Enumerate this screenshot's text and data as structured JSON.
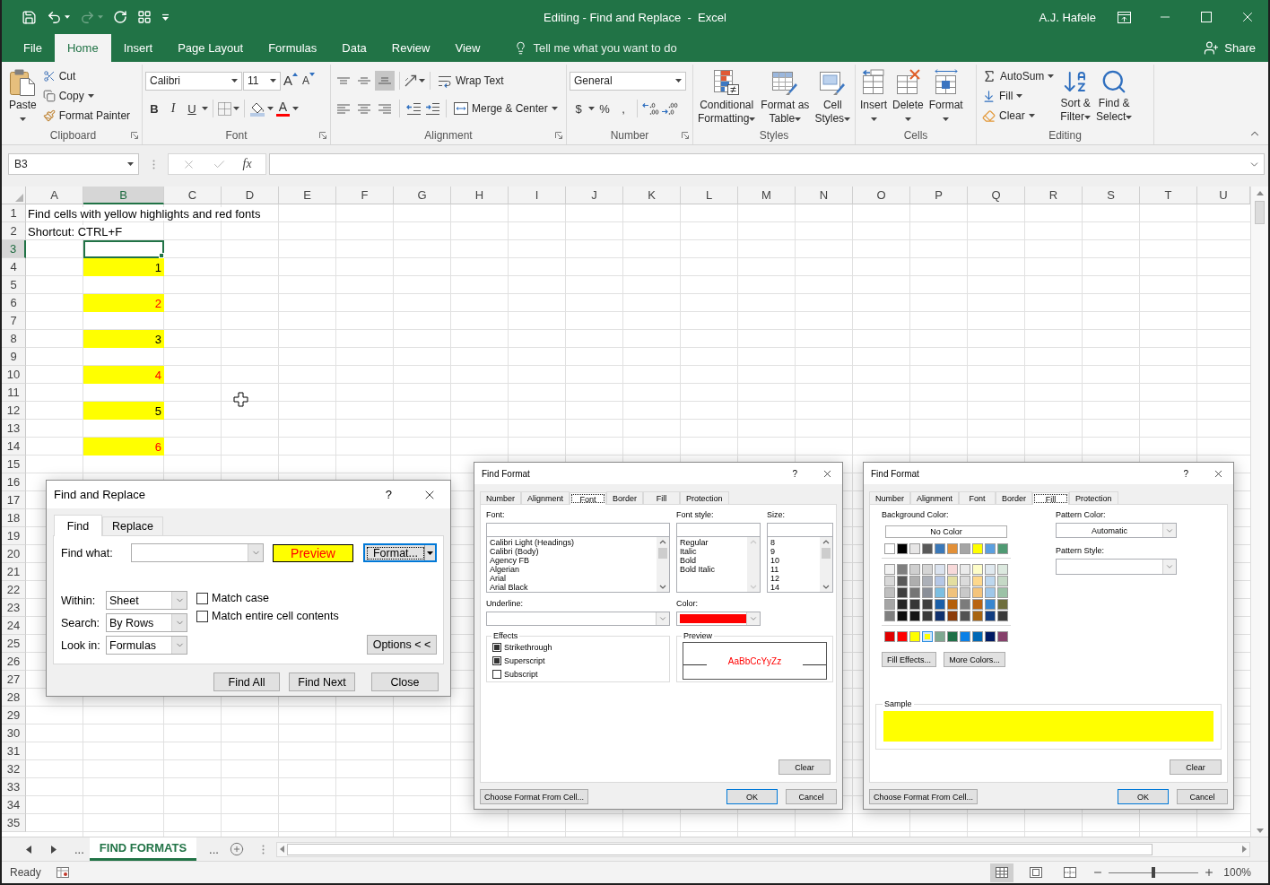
{
  "title_bar": {
    "title": "Editing - Find and Replace  -  Excel",
    "user": "A.J. Hafele"
  },
  "menu": {
    "tabs": [
      {
        "label": "File",
        "selected": false
      },
      {
        "label": "Home",
        "selected": true
      },
      {
        "label": "Insert",
        "selected": false
      },
      {
        "label": "Page Layout",
        "selected": false
      },
      {
        "label": "Formulas",
        "selected": false
      },
      {
        "label": "Data",
        "selected": false
      },
      {
        "label": "Review",
        "selected": false
      },
      {
        "label": "View",
        "selected": false
      }
    ],
    "tell_me": "Tell me what you want to do",
    "share": "Share"
  },
  "ribbon": {
    "clipboard": {
      "label": "Clipboard",
      "paste": "Paste",
      "cut": "Cut",
      "copy": "Copy",
      "format_painter": "Format Painter"
    },
    "font": {
      "label": "Font",
      "name": "Calibri",
      "size": "11",
      "grow": "A",
      "shrink": "A",
      "bold": "B",
      "italic": "I",
      "underline": "U",
      "font_color": "A"
    },
    "alignment": {
      "label": "Alignment",
      "vertical_align": [
        {
          "kind": "top",
          "selected": false
        },
        {
          "kind": "middle",
          "selected": false
        },
        {
          "kind": "bottom",
          "selected": true
        }
      ],
      "horizontal_align": [
        {
          "kind": "left",
          "selected": false
        },
        {
          "kind": "center",
          "selected": false
        },
        {
          "kind": "right",
          "selected": false
        }
      ],
      "wrap_text": "Wrap Text",
      "merge_center": "Merge & Center"
    },
    "number": {
      "label": "Number",
      "format": "General",
      "currency": "$",
      "percent": "%",
      "comma": ","
    },
    "styles": {
      "label": "Styles",
      "buttons": [
        {
          "kind": "conditional",
          "lines": [
            "Conditional",
            "Formatting"
          ]
        },
        {
          "kind": "table",
          "lines": [
            "Format as",
            "Table"
          ]
        },
        {
          "kind": "cell_styles",
          "lines": [
            "Cell",
            "Styles"
          ]
        }
      ]
    },
    "cells": {
      "label": "Cells",
      "buttons": [
        {
          "kind": "insert",
          "label": "Insert"
        },
        {
          "kind": "delete",
          "label": "Delete"
        },
        {
          "kind": "format",
          "label": "Format"
        }
      ]
    },
    "editing": {
      "label": "Editing",
      "autosum": "AutoSum",
      "fill": "Fill",
      "clear": "Clear",
      "sort_lines": [
        "Sort &",
        "Filter"
      ],
      "find_lines": [
        "Find &",
        "Select"
      ]
    }
  },
  "formula_bar": {
    "name_box": "B3",
    "function_button": "fx"
  },
  "sheet": {
    "columns": [
      {
        "label": "A",
        "selected": false
      },
      {
        "label": "B",
        "selected": true
      },
      {
        "label": "C",
        "selected": false
      },
      {
        "label": "D",
        "selected": false
      },
      {
        "label": "E",
        "selected": false
      },
      {
        "label": "F",
        "selected": false
      },
      {
        "label": "G",
        "selected": false
      },
      {
        "label": "H",
        "selected": false
      },
      {
        "label": "I",
        "selected": false
      },
      {
        "label": "J",
        "selected": false
      },
      {
        "label": "K",
        "selected": false
      },
      {
        "label": "L",
        "selected": false
      },
      {
        "label": "M",
        "selected": false
      },
      {
        "label": "N",
        "selected": false
      },
      {
        "label": "O",
        "selected": false
      },
      {
        "label": "P",
        "selected": false
      },
      {
        "label": "Q",
        "selected": false
      },
      {
        "label": "R",
        "selected": false
      },
      {
        "label": "S",
        "selected": false
      },
      {
        "label": "T",
        "selected": false
      },
      {
        "label": "U",
        "selected": false
      }
    ],
    "rows": [
      {
        "number": "1",
        "selected": false,
        "column_a": "Find cells with yellow highlights and red fonts"
      },
      {
        "number": "2",
        "selected": false,
        "column_a": "Shortcut: CTRL+F"
      },
      {
        "number": "3",
        "selected": true,
        "column_b": {
          "active": true
        }
      },
      {
        "number": "4",
        "selected": false,
        "column_b": {
          "value": "1",
          "highlighted": true,
          "red_font": false
        }
      },
      {
        "number": "5",
        "selected": false
      },
      {
        "number": "6",
        "selected": false,
        "column_b": {
          "value": "2",
          "highlighted": true,
          "red_font": true
        }
      },
      {
        "number": "7",
        "selected": false
      },
      {
        "number": "8",
        "selected": false,
        "column_b": {
          "value": "3",
          "highlighted": true,
          "red_font": false
        }
      },
      {
        "number": "9",
        "selected": false
      },
      {
        "number": "10",
        "selected": false,
        "column_b": {
          "value": "4",
          "highlighted": true,
          "red_font": true
        }
      },
      {
        "number": "11",
        "selected": false
      },
      {
        "number": "12",
        "selected": false,
        "column_b": {
          "value": "5",
          "highlighted": true,
          "red_font": false
        }
      },
      {
        "number": "13",
        "selected": false
      },
      {
        "number": "14",
        "selected": false,
        "column_b": {
          "value": "6",
          "highlighted": true,
          "red_font": true
        }
      },
      {
        "number": "15",
        "selected": false
      },
      {
        "number": "16",
        "selected": false
      },
      {
        "number": "17",
        "selected": false
      },
      {
        "number": "18",
        "selected": false
      },
      {
        "number": "19",
        "selected": false
      },
      {
        "number": "20",
        "selected": false
      },
      {
        "number": "21",
        "selected": false
      },
      {
        "number": "22",
        "selected": false
      },
      {
        "number": "23",
        "selected": false
      },
      {
        "number": "24",
        "selected": false
      },
      {
        "number": "25",
        "selected": false
      },
      {
        "number": "26",
        "selected": false
      },
      {
        "number": "27",
        "selected": false
      },
      {
        "number": "28",
        "selected": false
      },
      {
        "number": "29",
        "selected": false
      },
      {
        "number": "30",
        "selected": false
      },
      {
        "number": "31",
        "selected": false
      },
      {
        "number": "32",
        "selected": false
      },
      {
        "number": "33",
        "selected": false
      },
      {
        "number": "34",
        "selected": false
      },
      {
        "number": "35",
        "selected": false
      }
    ]
  },
  "sheet_tabs": {
    "more_before": "...",
    "tabs": [
      {
        "label": "FIND FORMATS",
        "selected": true
      }
    ],
    "more_after": "..."
  },
  "status_bar": {
    "status": "Ready",
    "views": [
      {
        "kind": "normal",
        "selected": true
      },
      {
        "kind": "page_layout",
        "selected": false
      },
      {
        "kind": "page_break",
        "selected": false
      }
    ],
    "zoom": {
      "level": 0.5,
      "reading": "100%"
    }
  },
  "find_replace": {
    "title": "Find and Replace",
    "help": "?",
    "tabs": [
      {
        "label": "Find",
        "selected": true
      },
      {
        "label": "Replace",
        "selected": false
      }
    ],
    "find_what": {
      "label": "Find what:"
    },
    "preview": "Preview",
    "format_button": "Format...",
    "selects": [
      {
        "label": "Within:",
        "value": "Sheet"
      },
      {
        "label": "Search:",
        "value": "By Rows"
      },
      {
        "label": "Look in:",
        "value": "Formulas"
      }
    ],
    "checkboxes": [
      {
        "label": "Match case",
        "checked": false
      },
      {
        "label": "Match entire cell contents",
        "checked": false
      }
    ],
    "options_button": "Options < <",
    "buttons": [
      "Find All",
      "Find Next",
      "Close"
    ]
  },
  "font_dialog": {
    "title": "Find Format",
    "help": "?",
    "tabs": [
      {
        "label": "Number",
        "selected": false
      },
      {
        "label": "Alignment",
        "selected": false
      },
      {
        "label": "Font",
        "selected": true
      },
      {
        "label": "Border",
        "selected": false
      },
      {
        "label": "Fill",
        "selected": false
      },
      {
        "label": "Protection",
        "selected": false
      }
    ],
    "lists": [
      {
        "label": "Font:",
        "items": [
          "Calibri Light (Headings)",
          "Calibri (Body)",
          "Agency FB",
          "Algerian",
          "Arial",
          "Arial Black"
        ]
      },
      {
        "label": "Font style:",
        "items": [
          "Regular",
          "Italic",
          "Bold",
          "Bold Italic"
        ]
      },
      {
        "label": "Size:",
        "items": [
          "8",
          "9",
          "10",
          "11",
          "12",
          "14"
        ]
      }
    ],
    "underline": {
      "label": "Underline:"
    },
    "color": {
      "label": "Color:",
      "color": "#ff0000"
    },
    "effects": {
      "label": "Effects",
      "items": [
        {
          "label": "Strikethrough",
          "checked": false,
          "mixed": true
        },
        {
          "label": "Superscript",
          "checked": false,
          "mixed": true
        },
        {
          "label": "Subscript",
          "checked": false,
          "mixed": false
        }
      ]
    },
    "preview": {
      "label": "Preview",
      "sample": "AaBbCcYyZz"
    },
    "clear": "Clear",
    "choose_from_cell": "Choose Format From Cell...",
    "ok": "OK",
    "cancel": "Cancel"
  },
  "fill_dialog": {
    "title": "Find Format",
    "help": "?",
    "tabs": [
      {
        "label": "Number",
        "selected": false
      },
      {
        "label": "Alignment",
        "selected": false
      },
      {
        "label": "Font",
        "selected": false
      },
      {
        "label": "Border",
        "selected": false
      },
      {
        "label": "Fill",
        "selected": true
      },
      {
        "label": "Protection",
        "selected": false
      }
    ],
    "background": {
      "label": "Background Color:",
      "no_color": "No Color",
      "theme_colors": [
        {
          "color": "#ffffff",
          "selected": false
        },
        {
          "color": "#000000",
          "selected": false
        },
        {
          "color": "#e7e6e6",
          "selected": false
        },
        {
          "color": "#595959",
          "selected": false
        },
        {
          "color": "#3a78b9",
          "selected": false
        },
        {
          "color": "#e29038",
          "selected": false
        },
        {
          "color": "#a5a5a5",
          "selected": false
        },
        {
          "color": "#ffff00",
          "selected": false
        },
        {
          "color": "#5b9fe0",
          "selected": false
        },
        {
          "color": "#4f9a73",
          "selected": false
        }
      ],
      "tint_rows": [
        {
          "swatches": [
            {
              "color": "#f2f2f2",
              "selected": false
            },
            {
              "color": "#7f7f7f",
              "selected": false
            },
            {
              "color": "#cfcfcf",
              "selected": false
            },
            {
              "color": "#d5d5d5",
              "selected": false
            },
            {
              "color": "#dbe3ef",
              "selected": false
            },
            {
              "color": "#f7d9d9",
              "selected": false
            },
            {
              "color": "#ebebeb",
              "selected": false
            },
            {
              "color": "#fefdc8",
              "selected": false
            },
            {
              "color": "#e0e9ef",
              "selected": false
            },
            {
              "color": "#dce9df",
              "selected": false
            }
          ]
        },
        {
          "swatches": [
            {
              "color": "#d8d8d8",
              "selected": false
            },
            {
              "color": "#595959",
              "selected": false
            },
            {
              "color": "#aeaeae",
              "selected": false
            },
            {
              "color": "#acb0b8",
              "selected": false
            },
            {
              "color": "#b5c7e6",
              "selected": false
            },
            {
              "color": "#e3dea0",
              "selected": false
            },
            {
              "color": "#dbdbdb",
              "selected": false
            },
            {
              "color": "#fed88c",
              "selected": false
            },
            {
              "color": "#bdd7ee",
              "selected": false
            },
            {
              "color": "#c5d9c6",
              "selected": false
            }
          ]
        },
        {
          "swatches": [
            {
              "color": "#bfbfbf",
              "selected": false
            },
            {
              "color": "#3f3f3f",
              "selected": false
            },
            {
              "color": "#757575",
              "selected": false
            },
            {
              "color": "#8a8f98",
              "selected": false
            },
            {
              "color": "#7cbfe2",
              "selected": false
            },
            {
              "color": "#f0c27c",
              "selected": false
            },
            {
              "color": "#c9c9c9",
              "selected": false
            },
            {
              "color": "#f4c47b",
              "selected": false
            },
            {
              "color": "#9fc7e9",
              "selected": false
            },
            {
              "color": "#9bc2a6",
              "selected": false
            }
          ]
        },
        {
          "swatches": [
            {
              "color": "#a5a5a5",
              "selected": false
            },
            {
              "color": "#262626",
              "selected": false
            },
            {
              "color": "#363636",
              "selected": false
            },
            {
              "color": "#3f3f3f",
              "selected": false
            },
            {
              "color": "#1a5fa8",
              "selected": false
            },
            {
              "color": "#b45f0b",
              "selected": false
            },
            {
              "color": "#7b7b7b",
              "selected": false
            },
            {
              "color": "#b96412",
              "selected": false
            },
            {
              "color": "#3786d0",
              "selected": false
            },
            {
              "color": "#6e6e3d",
              "selected": false
            }
          ]
        },
        {
          "swatches": [
            {
              "color": "#7f7f7f",
              "selected": false
            },
            {
              "color": "#0d0d0d",
              "selected": false
            },
            {
              "color": "#161616",
              "selected": false
            },
            {
              "color": "#383838",
              "selected": false
            },
            {
              "color": "#0f306e",
              "selected": false
            },
            {
              "color": "#8c3c0a",
              "selected": false
            },
            {
              "color": "#525252",
              "selected": false
            },
            {
              "color": "#a86410",
              "selected": false
            },
            {
              "color": "#103c80",
              "selected": false
            },
            {
              "color": "#3a3a3a",
              "selected": false
            }
          ]
        }
      ],
      "standard_colors": [
        {
          "color": "#e00000",
          "selected": false
        },
        {
          "color": "#ff0000",
          "selected": false
        },
        {
          "color": "#ffff00",
          "selected": false
        },
        {
          "color": "#ffff00",
          "selected": true
        },
        {
          "color": "#7fa891",
          "selected": false
        },
        {
          "color": "#1f7048",
          "selected": false
        },
        {
          "color": "#0b80e6",
          "selected": false
        },
        {
          "color": "#0068b5",
          "selected": false
        },
        {
          "color": "#001a63",
          "selected": false
        },
        {
          "color": "#86406b",
          "selected": false
        }
      ]
    },
    "fill_effects": "Fill Effects...",
    "more_colors": "More Colors...",
    "pattern_color": {
      "label": "Pattern Color:",
      "value": "Automatic"
    },
    "pattern_style": {
      "label": "Pattern Style:"
    },
    "sample": {
      "label": "Sample"
    },
    "clear": "Clear",
    "choose_from_cell": "Choose Format From Cell...",
    "ok": "OK",
    "cancel": "Cancel"
  }
}
